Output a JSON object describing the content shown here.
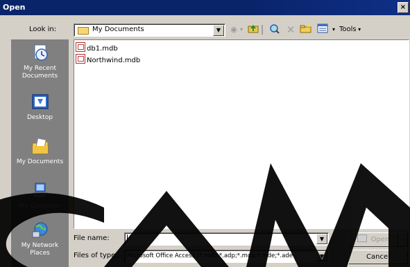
{
  "window": {
    "title": "Open",
    "close_glyph": "×"
  },
  "toolbar": {
    "lookin_label": "Look in:",
    "lookin_value": "My Documents",
    "tools_label": "Tools"
  },
  "places": [
    {
      "label": "My Recent Documents",
      "icon": "recent-documents-icon"
    },
    {
      "label": "Desktop",
      "icon": "desktop-icon"
    },
    {
      "label": "My Documents",
      "icon": "my-documents-icon"
    },
    {
      "label": "My Computer",
      "icon": "my-computer-icon"
    },
    {
      "label": "My Network Places",
      "icon": "network-places-icon"
    }
  ],
  "files": [
    {
      "name": "db1.mdb"
    },
    {
      "name": "Northwind.mdb"
    }
  ],
  "bottom": {
    "filename_label": "File name:",
    "filename_value": "",
    "filetype_label": "Files of type:",
    "filetype_value": "Microsoft Office Access (*.mdb;*.adp;*.mda;*.mde;*.ade",
    "open_label": "Open",
    "cancel_label": "Cancel"
  }
}
